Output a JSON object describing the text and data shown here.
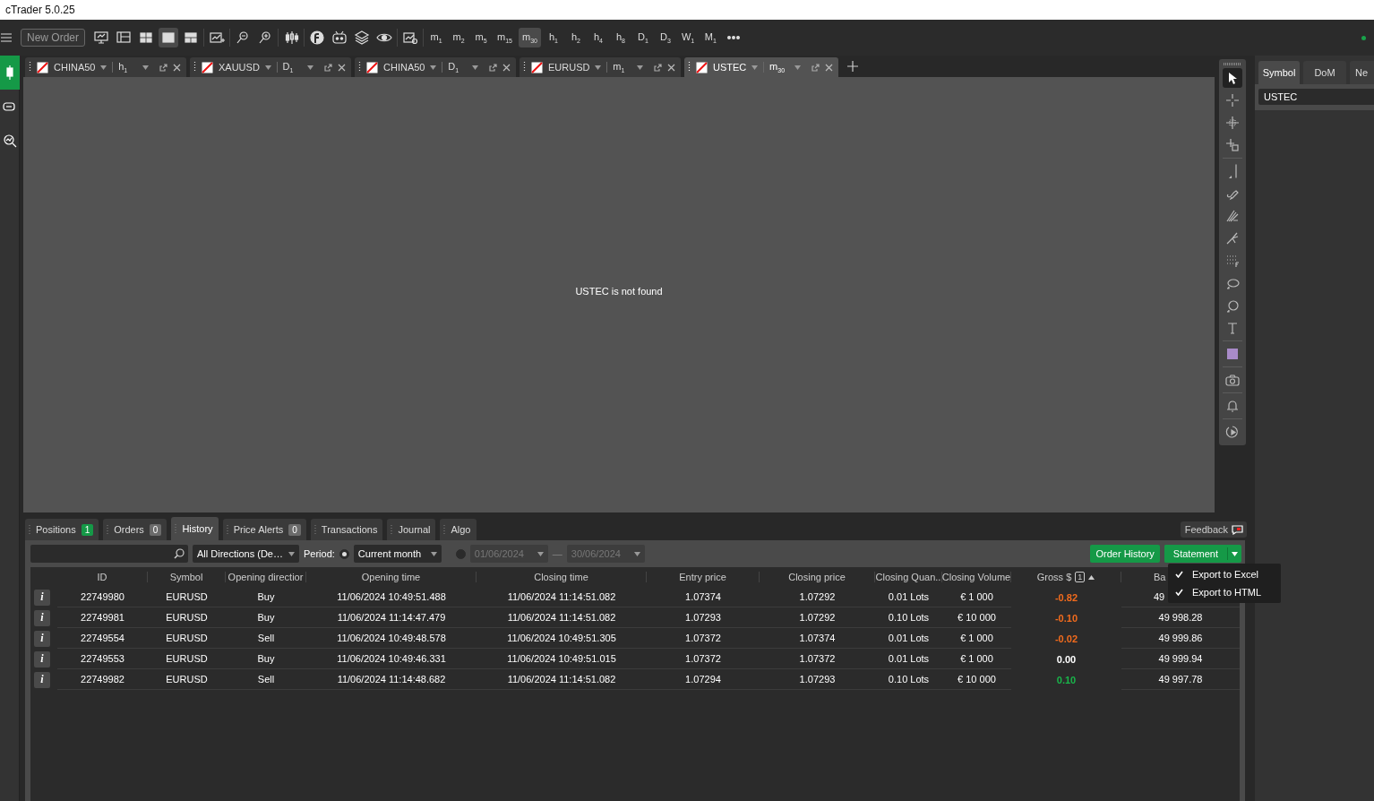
{
  "window": {
    "title": "cTrader 5.0.25"
  },
  "toolbar": {
    "new_order": "New Order",
    "layout_buttons": [
      {
        "kind": "screen",
        "selected": false
      },
      {
        "kind": "panels",
        "selected": false
      },
      {
        "kind": "four",
        "selected": false
      },
      {
        "kind": "single",
        "selected": true
      },
      {
        "kind": "split",
        "selected": false
      }
    ],
    "timeframes": [
      {
        "label": "m$_{1}$",
        "selected": false
      },
      {
        "label": "m$_{2}$",
        "selected": false
      },
      {
        "label": "m$_{5}$",
        "selected": false
      },
      {
        "label": "m$_{15}$",
        "selected": false
      },
      {
        "label": "m$_{30}$",
        "selected": true
      },
      {
        "label": "h$_{1}$",
        "selected": false
      },
      {
        "label": "h$_{2}$",
        "selected": false
      },
      {
        "label": "h$_{4}$",
        "selected": false
      },
      {
        "label": "h$_{8}$",
        "selected": false
      },
      {
        "label": "D$_{1}$",
        "selected": false
      },
      {
        "label": "D$_{3}$",
        "selected": false
      },
      {
        "label": "W$_{1}$",
        "selected": false
      },
      {
        "label": "M$_{1}$",
        "selected": false
      }
    ]
  },
  "sidebar": {
    "items": [
      {
        "kind": "chart",
        "selected": true
      },
      {
        "kind": "copy",
        "selected": false
      },
      {
        "kind": "analyze",
        "selected": false
      }
    ]
  },
  "chart_tabs": [
    {
      "symbol": "CHINA50",
      "timeframe": "h$_{1}$",
      "selected": false
    },
    {
      "symbol": "XAUUSD",
      "timeframe": "D$_{1}$",
      "selected": false
    },
    {
      "symbol": "CHINA50",
      "timeframe": "D$_{1}$",
      "selected": false
    },
    {
      "symbol": "EURUSD",
      "timeframe": "m$_{1}$",
      "selected": false
    },
    {
      "symbol": "USTEC",
      "timeframe": "m$_{30}$",
      "selected": true
    }
  ],
  "chart": {
    "message": "USTEC is not found"
  },
  "drawing_tools": [
    {
      "kind": "cursor",
      "selected": true
    },
    {
      "kind": "crosshair",
      "selected": false
    },
    {
      "kind": "crosshair2",
      "selected": false
    },
    {
      "kind": "measure",
      "selected": false
    },
    {
      "kind": "line",
      "selected": false
    },
    {
      "kind": "pen",
      "selected": false
    },
    {
      "kind": "fan",
      "selected": false
    },
    {
      "kind": "fork",
      "selected": false
    },
    {
      "kind": "grid",
      "selected": false
    },
    {
      "kind": "ellipse",
      "selected": false
    },
    {
      "kind": "circle",
      "selected": false
    },
    {
      "kind": "text",
      "selected": false
    },
    {
      "kind": "color",
      "selected": false,
      "color": "#a98bc9"
    },
    {
      "kind": "camera",
      "selected": false
    },
    {
      "kind": "bell",
      "selected": false
    },
    {
      "kind": "replay",
      "selected": false
    }
  ],
  "side_panel": {
    "tabs": [
      {
        "label": "Symbol",
        "selected": true
      },
      {
        "label": "DoM",
        "selected": false
      },
      {
        "label": "Ne",
        "selected": false
      }
    ],
    "symbol": "USTEC"
  },
  "bottom_panel": {
    "tabs": [
      {
        "label": "Positions",
        "count": "1",
        "color": "#159947",
        "selected": false
      },
      {
        "label": "Orders",
        "count": "0",
        "color": "#6b6b6b",
        "selected": false
      },
      {
        "label": "History",
        "selected": true
      },
      {
        "label": "Price Alerts",
        "count": "0",
        "color": "#6b6b6b",
        "selected": false
      },
      {
        "label": "Transactions",
        "selected": false
      },
      {
        "label": "Journal",
        "selected": false
      },
      {
        "label": "Algo",
        "selected": false
      }
    ],
    "feedback": "Feedback",
    "filters": {
      "direction": "All Directions (De…",
      "period_label": "Period:",
      "periods": [
        {
          "value": "Current month",
          "selected": true
        },
        {
          "from": "01/06/2024",
          "to": "30/06/2024",
          "selected": false
        }
      ],
      "separator": "—"
    },
    "order_history": "Order History",
    "statement": "Statement",
    "statement_menu": [
      {
        "label": "Export to Excel",
        "checked": true
      },
      {
        "label": "Export to HTML",
        "checked": true
      }
    ],
    "table": {
      "columns": [
        {
          "label": "ID"
        },
        {
          "label": "Symbol"
        },
        {
          "label": "Opening directior"
        },
        {
          "label": "Opening time"
        },
        {
          "label": "Closing time"
        },
        {
          "label": "Entry price"
        },
        {
          "label": "Closing price"
        },
        {
          "label": "Closing Quan.."
        },
        {
          "label": "Closing Volume"
        },
        {
          "label": "Gross $",
          "sort_order": "1"
        },
        {
          "label": "Ba"
        }
      ],
      "rows": [
        {
          "cells": [
            "22749980",
            "EURUSD",
            "Buy",
            "11/06/2024 10:49:51.488",
            "11/06/2024 11:14:51.082",
            "1.07374",
            "1.07292",
            "0.01 Lots",
            "€ 1 000",
            "-0.82",
            "49"
          ],
          "color": "#f26b1d",
          "info": "i"
        },
        {
          "cells": [
            "22749981",
            "EURUSD",
            "Buy",
            "11/06/2024 11:14:47.479",
            "11/06/2024 11:14:51.082",
            "1.07293",
            "1.07292",
            "0.10 Lots",
            "€ 10 000",
            "-0.10",
            "49 998.28"
          ],
          "color": "#f26b1d",
          "info": "i"
        },
        {
          "cells": [
            "22749554",
            "EURUSD",
            "Sell",
            "11/06/2024 10:49:48.578",
            "11/06/2024 10:49:51.305",
            "1.07372",
            "1.07374",
            "0.01 Lots",
            "€ 1 000",
            "-0.02",
            "49 999.86"
          ],
          "color": "#f26b1d",
          "info": "i"
        },
        {
          "cells": [
            "22749553",
            "EURUSD",
            "Buy",
            "11/06/2024 10:49:46.331",
            "11/06/2024 10:49:51.015",
            "1.07372",
            "1.07372",
            "0.01 Lots",
            "€ 1 000",
            "0.00",
            "49 999.94"
          ],
          "color": "#ffffff",
          "info": "i"
        },
        {
          "cells": [
            "22749982",
            "EURUSD",
            "Sell",
            "11/06/2024 11:14:48.682",
            "11/06/2024 11:14:51.082",
            "1.07294",
            "1.07293",
            "0.10 Lots",
            "€ 10 000",
            "0.10",
            "49 997.78"
          ],
          "color": "#19b54a",
          "info": "i"
        }
      ]
    }
  }
}
